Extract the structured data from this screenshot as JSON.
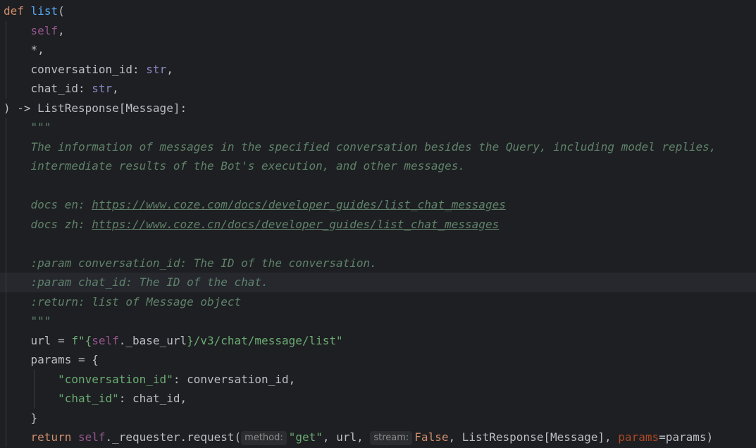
{
  "colors": {
    "background": "#1e1f22",
    "current_line": "#26282e",
    "keyword": "#cf8e6d",
    "function_name": "#56a8f5",
    "self": "#94558d",
    "builtin": "#8888c6",
    "string": "#6aab73",
    "docstring": "#5f826b",
    "named_param": "#aa4926",
    "default_text": "#bcbec4"
  },
  "code": {
    "current_line_index": 14,
    "lines": [
      [
        {
          "t": "def",
          "c": "kw"
        },
        {
          "t": " "
        },
        {
          "t": "list",
          "c": "fn"
        },
        {
          "t": "("
        }
      ],
      [
        {
          "t": "    "
        },
        {
          "t": "self",
          "c": "self"
        },
        {
          "t": ","
        }
      ],
      [
        {
          "t": "    *,"
        }
      ],
      [
        {
          "t": "    conversation_id: "
        },
        {
          "t": "str",
          "c": "builtin"
        },
        {
          "t": ","
        }
      ],
      [
        {
          "t": "    chat_id: "
        },
        {
          "t": "str",
          "c": "builtin"
        },
        {
          "t": ","
        }
      ],
      [
        {
          "t": ") -> ListResponse[Message]:"
        }
      ],
      [
        {
          "t": "    "
        },
        {
          "t": "\"\"\"",
          "c": "doc"
        }
      ],
      [
        {
          "t": "    "
        },
        {
          "t": "The information of messages in the specified conversation besides the Query, including model replies,",
          "c": "doc"
        }
      ],
      [
        {
          "t": "    "
        },
        {
          "t": "intermediate results of the Bot's execution, and other messages.",
          "c": "doc"
        }
      ],
      [],
      [
        {
          "t": "    "
        },
        {
          "t": "docs en: ",
          "c": "doc"
        },
        {
          "t": "https://www.coze.com/docs/developer_guides/list_chat_messages",
          "c": "link"
        }
      ],
      [
        {
          "t": "    "
        },
        {
          "t": "docs zh: ",
          "c": "doc"
        },
        {
          "t": "https://www.coze.cn/docs/developer_guides/list_chat_messages",
          "c": "link"
        }
      ],
      [],
      [
        {
          "t": "    "
        },
        {
          "t": ":param",
          "c": "doctag"
        },
        {
          "t": " conversation_id: The ID of the conversation.",
          "c": "doc"
        }
      ],
      [
        {
          "t": "    "
        },
        {
          "t": ":param",
          "c": "doctag"
        },
        {
          "t": " chat_id: The ID of the chat.",
          "c": "doc"
        }
      ],
      [
        {
          "t": "    "
        },
        {
          "t": ":return",
          "c": "doctag"
        },
        {
          "t": ": list of Message object",
          "c": "doc"
        }
      ],
      [
        {
          "t": "    "
        },
        {
          "t": "\"\"\"",
          "c": "doc"
        }
      ],
      [
        {
          "t": "    url = "
        },
        {
          "t": "f\"{",
          "c": "str"
        },
        {
          "t": "self",
          "c": "self"
        },
        {
          "t": "._base_url"
        },
        {
          "t": "}/v3/chat/message/list\"",
          "c": "str"
        }
      ],
      [
        {
          "t": "    params = {"
        }
      ],
      [
        {
          "t": "        "
        },
        {
          "t": "\"conversation_id\"",
          "c": "str"
        },
        {
          "t": ": conversation_id,"
        }
      ],
      [
        {
          "t": "        "
        },
        {
          "t": "\"chat_id\"",
          "c": "str"
        },
        {
          "t": ": chat_id,"
        }
      ],
      [
        {
          "t": "    }"
        }
      ],
      [
        {
          "t": "    "
        },
        {
          "t": "return",
          "c": "kw"
        },
        {
          "t": " "
        },
        {
          "t": "self",
          "c": "self"
        },
        {
          "t": "._requester.request("
        },
        {
          "t": "method:",
          "c": "hint"
        },
        {
          "t": "\"get\"",
          "c": "str"
        },
        {
          "t": ", url, "
        },
        {
          "t": "stream:",
          "c": "hint"
        },
        {
          "t": "False",
          "c": "kw"
        },
        {
          "t": ", ListResponse[Message], "
        },
        {
          "t": "params",
          "c": "param"
        },
        {
          "t": "=params)"
        }
      ]
    ]
  }
}
